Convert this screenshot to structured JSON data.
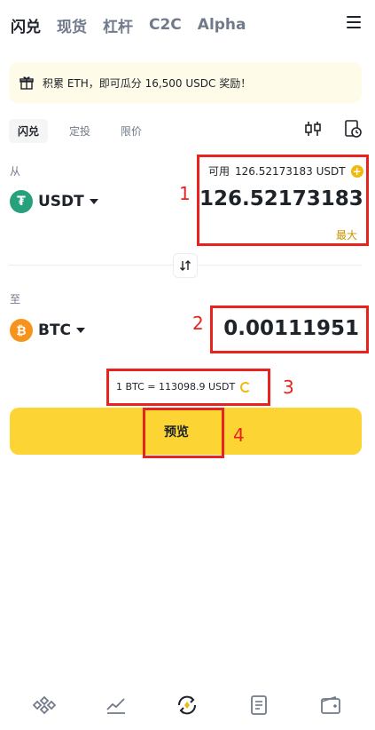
{
  "top_tabs": [
    "闪兑",
    "现货",
    "杠杆",
    "C2C",
    "Alpha"
  ],
  "banner": {
    "text": "积累 ETH，即可瓜分 16,500 USDC 奖励！"
  },
  "sub_tabs": [
    "闪兑",
    "定投",
    "限价"
  ],
  "from": {
    "label": "从",
    "coin": "USDT",
    "available_label": "可用",
    "available_value": "126.52173183 USDT",
    "amount": "126.52173183",
    "max_label": "最大"
  },
  "to": {
    "label": "至",
    "coin": "BTC",
    "amount": "0.00111951"
  },
  "rate": "1 BTC = 113098.9 USDT",
  "preview_button": "预览",
  "annotations": [
    "1",
    "2",
    "3",
    "4"
  ],
  "colors": {
    "accent": "#fcd535",
    "annotation": "#e8221c",
    "tether": "#26a17b",
    "bitcoin": "#f7931a",
    "link": "#c99400"
  },
  "icons": [
    "menu-icon",
    "gift-icon",
    "candlestick-icon",
    "order-history-icon",
    "swap-direction-icon",
    "home-icon",
    "markets-icon",
    "trade-icon",
    "orders-icon",
    "wallet-icon"
  ]
}
